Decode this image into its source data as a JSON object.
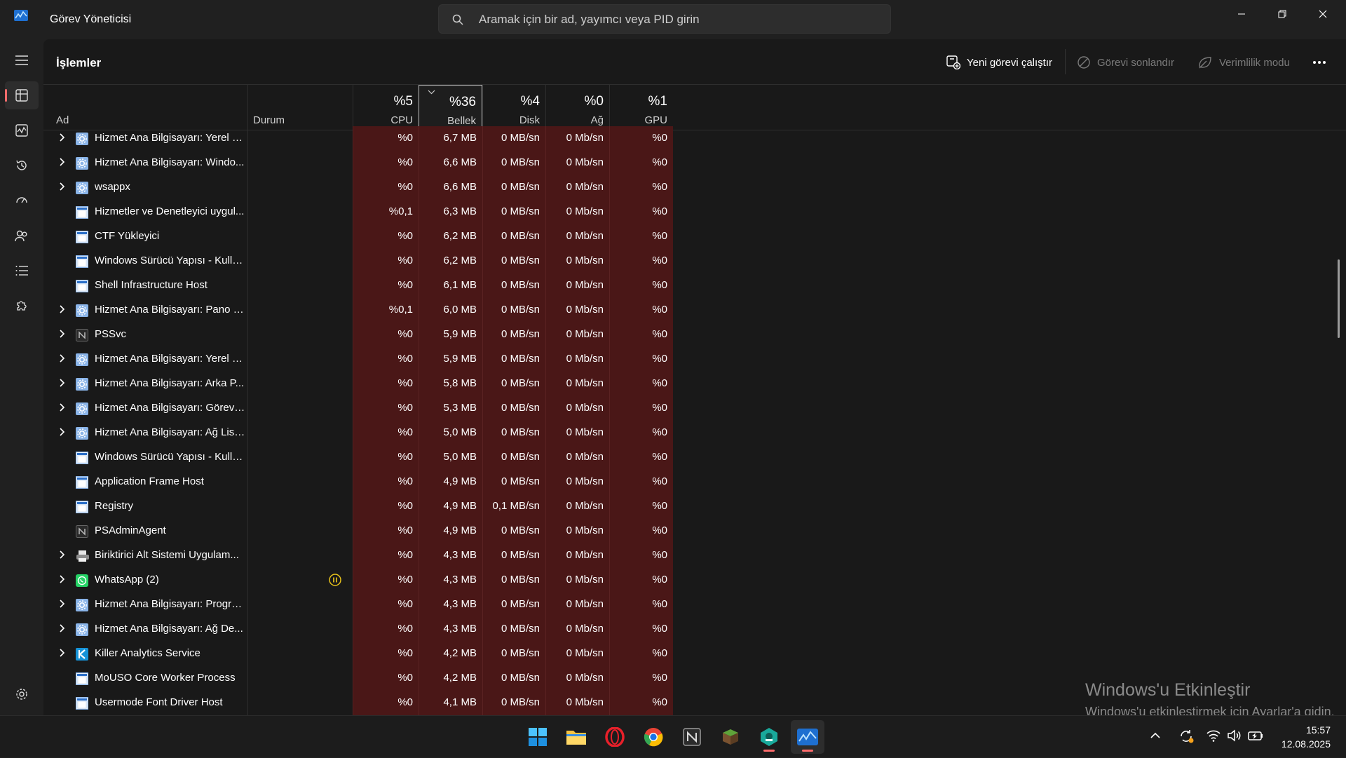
{
  "titlebar": {
    "title": "Görev Yöneticisi",
    "search_placeholder": "Aramak için bir ad, yayımcı veya PID girin"
  },
  "toolbar": {
    "page_title": "İşlemler",
    "run_new_task": "Yeni görevi çalıştır",
    "end_task": "Görevi sonlandır",
    "efficiency_mode": "Verimlilik modu"
  },
  "columns": {
    "name": "Ad",
    "status": "Durum",
    "cpu_pct": "%5",
    "cpu_label": "CPU",
    "mem_pct": "%36",
    "mem_label": "Bellek",
    "disk_pct": "%4",
    "disk_label": "Disk",
    "net_pct": "%0",
    "net_label": "Ağ",
    "gpu_pct": "%1",
    "gpu_label": "GPU"
  },
  "rows": [
    {
      "name": "Hizmet Ana Bilgisayarı: Yerel S...",
      "expand": true,
      "icon": "gear-icon",
      "status": "",
      "cpu": "%0",
      "mem": "6,7 MB",
      "disk": "0 MB/sn",
      "net": "0 Mb/sn",
      "gpu": "%0"
    },
    {
      "name": "Hizmet Ana Bilgisayarı: Windo...",
      "expand": true,
      "icon": "gear-icon",
      "status": "",
      "cpu": "%0",
      "mem": "6,6 MB",
      "disk": "0 MB/sn",
      "net": "0 Mb/sn",
      "gpu": "%0"
    },
    {
      "name": "wsappx",
      "expand": true,
      "icon": "gear-icon",
      "status": "",
      "cpu": "%0",
      "mem": "6,6 MB",
      "disk": "0 MB/sn",
      "net": "0 Mb/sn",
      "gpu": "%0"
    },
    {
      "name": "Hizmetler ve Denetleyici uygul...",
      "expand": false,
      "icon": "window-icon",
      "status": "",
      "cpu": "%0,1",
      "mem": "6,3 MB",
      "disk": "0 MB/sn",
      "net": "0 Mb/sn",
      "gpu": "%0"
    },
    {
      "name": "CTF Yükleyici",
      "expand": false,
      "icon": "window-icon",
      "status": "",
      "cpu": "%0",
      "mem": "6,2 MB",
      "disk": "0 MB/sn",
      "net": "0 Mb/sn",
      "gpu": "%0"
    },
    {
      "name": "Windows Sürücü Yapısı - Kulla...",
      "expand": false,
      "icon": "window-icon",
      "status": "",
      "cpu": "%0",
      "mem": "6,2 MB",
      "disk": "0 MB/sn",
      "net": "0 Mb/sn",
      "gpu": "%0"
    },
    {
      "name": "Shell Infrastructure Host",
      "expand": false,
      "icon": "window-icon",
      "status": "",
      "cpu": "%0",
      "mem": "6,1 MB",
      "disk": "0 MB/sn",
      "net": "0 Mb/sn",
      "gpu": "%0"
    },
    {
      "name": "Hizmet Ana Bilgisayarı: Pano K...",
      "expand": true,
      "icon": "gear-icon",
      "status": "",
      "cpu": "%0,1",
      "mem": "6,0 MB",
      "disk": "0 MB/sn",
      "net": "0 Mb/sn",
      "gpu": "%0"
    },
    {
      "name": "PSSvc",
      "expand": true,
      "icon": "n-app-icon",
      "status": "",
      "cpu": "%0",
      "mem": "5,9 MB",
      "disk": "0 MB/sn",
      "net": "0 Mb/sn",
      "gpu": "%0"
    },
    {
      "name": "Hizmet Ana Bilgisayarı: Yerel S...",
      "expand": true,
      "icon": "gear-icon",
      "status": "",
      "cpu": "%0",
      "mem": "5,9 MB",
      "disk": "0 MB/sn",
      "net": "0 Mb/sn",
      "gpu": "%0"
    },
    {
      "name": "Hizmet Ana Bilgisayarı: Arka P...",
      "expand": true,
      "icon": "gear-icon",
      "status": "",
      "cpu": "%0",
      "mem": "5,8 MB",
      "disk": "0 MB/sn",
      "net": "0 Mb/sn",
      "gpu": "%0"
    },
    {
      "name": "Hizmet Ana Bilgisayarı: Görev ...",
      "expand": true,
      "icon": "gear-icon",
      "status": "",
      "cpu": "%0",
      "mem": "5,3 MB",
      "disk": "0 MB/sn",
      "net": "0 Mb/sn",
      "gpu": "%0"
    },
    {
      "name": "Hizmet Ana Bilgisayarı: Ağ List...",
      "expand": true,
      "icon": "gear-icon",
      "status": "",
      "cpu": "%0",
      "mem": "5,0 MB",
      "disk": "0 MB/sn",
      "net": "0 Mb/sn",
      "gpu": "%0"
    },
    {
      "name": "Windows Sürücü Yapısı - Kulla...",
      "expand": false,
      "icon": "window-icon",
      "status": "",
      "cpu": "%0",
      "mem": "5,0 MB",
      "disk": "0 MB/sn",
      "net": "0 Mb/sn",
      "gpu": "%0"
    },
    {
      "name": "Application Frame Host",
      "expand": false,
      "icon": "window-icon",
      "status": "",
      "cpu": "%0",
      "mem": "4,9 MB",
      "disk": "0 MB/sn",
      "net": "0 Mb/sn",
      "gpu": "%0"
    },
    {
      "name": "Registry",
      "expand": false,
      "icon": "window-icon",
      "status": "",
      "cpu": "%0",
      "mem": "4,9 MB",
      "disk": "0,1 MB/sn",
      "net": "0 Mb/sn",
      "gpu": "%0"
    },
    {
      "name": "PSAdminAgent",
      "expand": false,
      "icon": "n-app-icon",
      "status": "",
      "cpu": "%0",
      "mem": "4,9 MB",
      "disk": "0 MB/sn",
      "net": "0 Mb/sn",
      "gpu": "%0"
    },
    {
      "name": "Biriktirici Alt Sistemi Uygulam...",
      "expand": true,
      "icon": "printer-icon",
      "status": "",
      "cpu": "%0",
      "mem": "4,3 MB",
      "disk": "0 MB/sn",
      "net": "0 Mb/sn",
      "gpu": "%0"
    },
    {
      "name": "WhatsApp (2)",
      "expand": true,
      "icon": "whatsapp-icon",
      "status": "paused",
      "cpu": "%0",
      "mem": "4,3 MB",
      "disk": "0 MB/sn",
      "net": "0 Mb/sn",
      "gpu": "%0"
    },
    {
      "name": "Hizmet Ana Bilgisayarı: Progra...",
      "expand": true,
      "icon": "gear-icon",
      "status": "",
      "cpu": "%0",
      "mem": "4,3 MB",
      "disk": "0 MB/sn",
      "net": "0 Mb/sn",
      "gpu": "%0"
    },
    {
      "name": "Hizmet Ana Bilgisayarı: Ağ De...",
      "expand": true,
      "icon": "gear-icon",
      "status": "",
      "cpu": "%0",
      "mem": "4,3 MB",
      "disk": "0 MB/sn",
      "net": "0 Mb/sn",
      "gpu": "%0"
    },
    {
      "name": "Killer Analytics Service",
      "expand": true,
      "icon": "killer-icon",
      "status": "",
      "cpu": "%0",
      "mem": "4,2 MB",
      "disk": "0 MB/sn",
      "net": "0 Mb/sn",
      "gpu": "%0"
    },
    {
      "name": "MoUSO Core Worker Process",
      "expand": false,
      "icon": "window-icon",
      "status": "",
      "cpu": "%0",
      "mem": "4,2 MB",
      "disk": "0 MB/sn",
      "net": "0 Mb/sn",
      "gpu": "%0"
    },
    {
      "name": "Usermode Font Driver Host",
      "expand": false,
      "icon": "window-icon",
      "status": "",
      "cpu": "%0",
      "mem": "4,1 MB",
      "disk": "0 MB/sn",
      "net": "0 Mb/sn",
      "gpu": "%0"
    }
  ],
  "watermark": {
    "line1": "Windows'u Etkinleştir",
    "line2": "Windows'u etkinleştirmek için Ayarlar'a gidin."
  },
  "taskbar": {
    "time": "15:57",
    "date": "12.08.2025"
  },
  "colors": {
    "heat": "#4a1717",
    "accent": "#ff6b6b",
    "status_paused": "#e8c21a"
  }
}
